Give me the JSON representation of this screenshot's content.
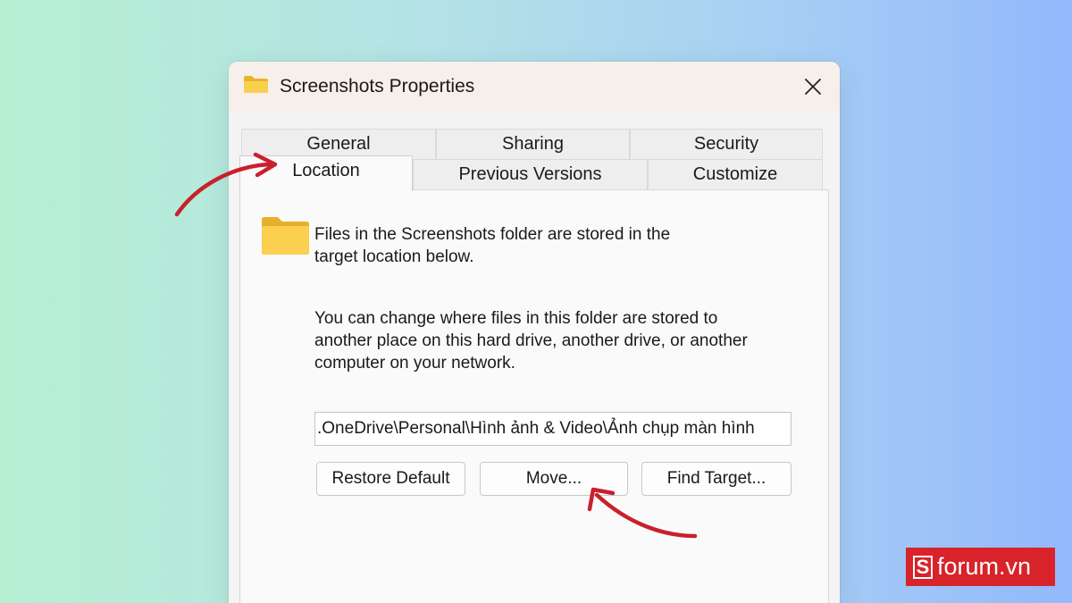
{
  "window": {
    "title": "Screenshots Properties",
    "title_icon": "folder-icon",
    "close_icon": "close-icon"
  },
  "tabs": {
    "row1": [
      {
        "label": "General"
      },
      {
        "label": "Sharing"
      },
      {
        "label": "Security"
      }
    ],
    "row2": [
      {
        "label": "Location",
        "active": true
      },
      {
        "label": "Previous Versions"
      },
      {
        "label": "Customize"
      }
    ]
  },
  "location_panel": {
    "intro_line1": "Files in the Screenshots folder are stored in the",
    "intro_line2": "target location below.",
    "desc_line1": "You can change where files in this folder are stored to",
    "desc_line2": "another place on this hard drive, another drive, or another",
    "desc_line3": "computer on your network.",
    "path_value": ".OneDrive\\Personal\\Hình ảnh & Video\\Ảnh chụp màn hình",
    "buttons": {
      "restore_default": "Restore Default",
      "move": "Move...",
      "find_target": "Find Target..."
    }
  },
  "watermark": {
    "logo_letter": "S",
    "logo_text": "forum.vn"
  },
  "colors": {
    "annotation_arrow": "#c8202c",
    "folder_yellow": "#f7c843",
    "logo_red": "#d8232a"
  }
}
